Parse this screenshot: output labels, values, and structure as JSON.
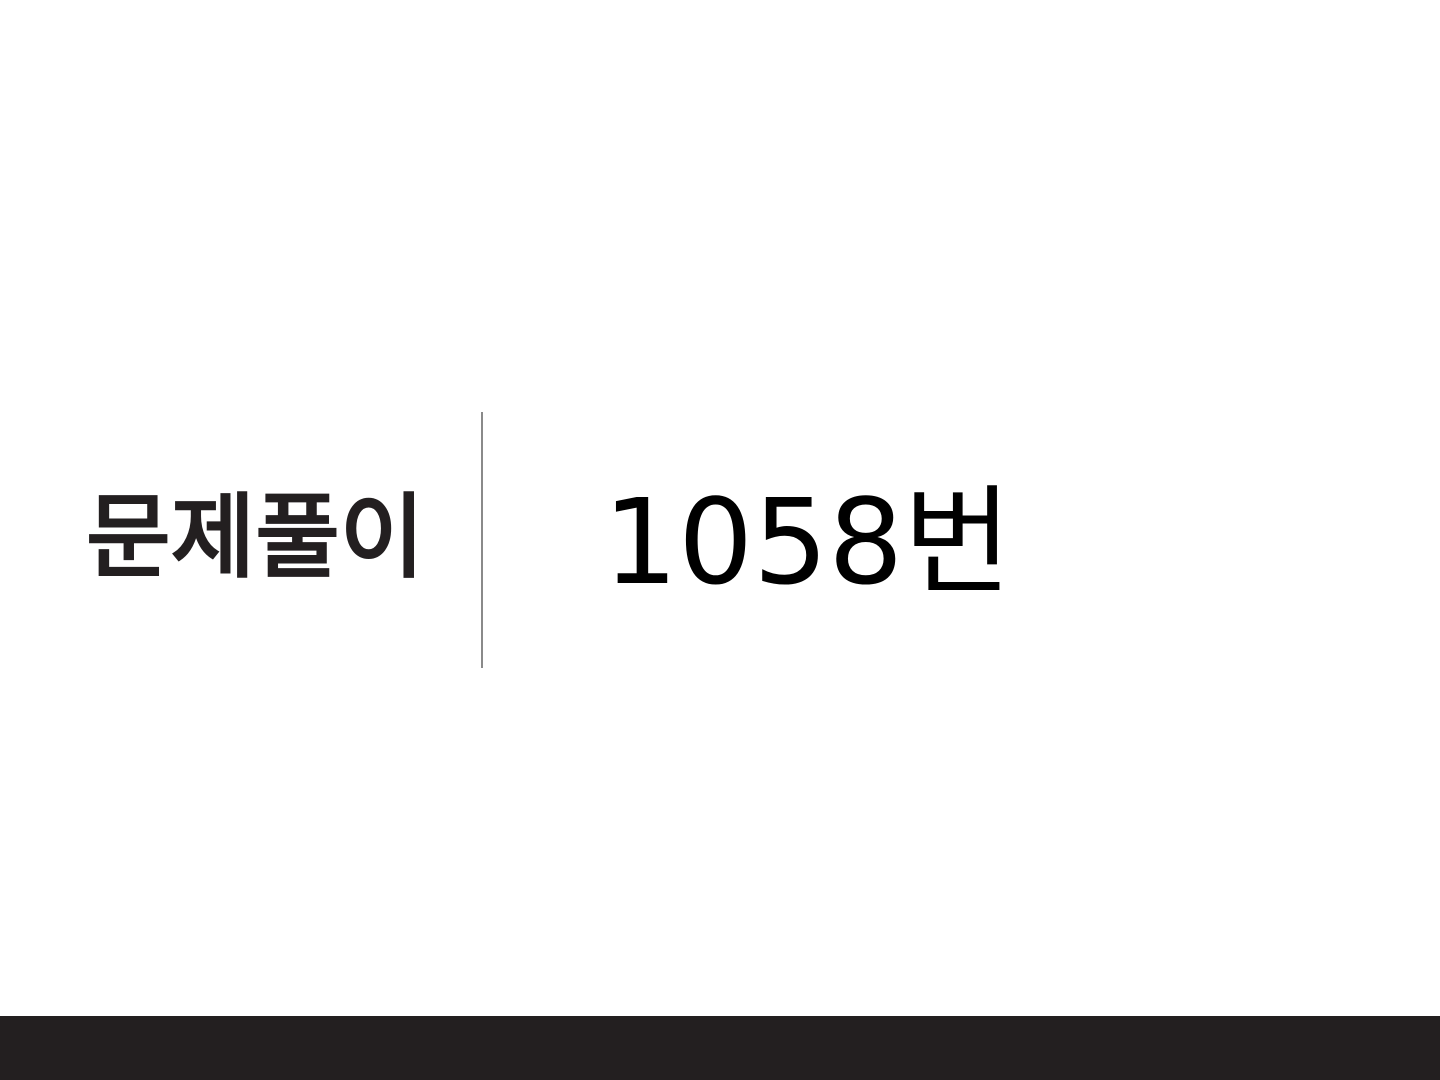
{
  "slide": {
    "section_label": "문제풀이",
    "problem_number": "1058번"
  },
  "colors": {
    "background": "#ffffff",
    "label_text": "#231f20",
    "number_text": "#000000",
    "divider": "#8a8a8a",
    "footer_bar": "#231f20"
  }
}
